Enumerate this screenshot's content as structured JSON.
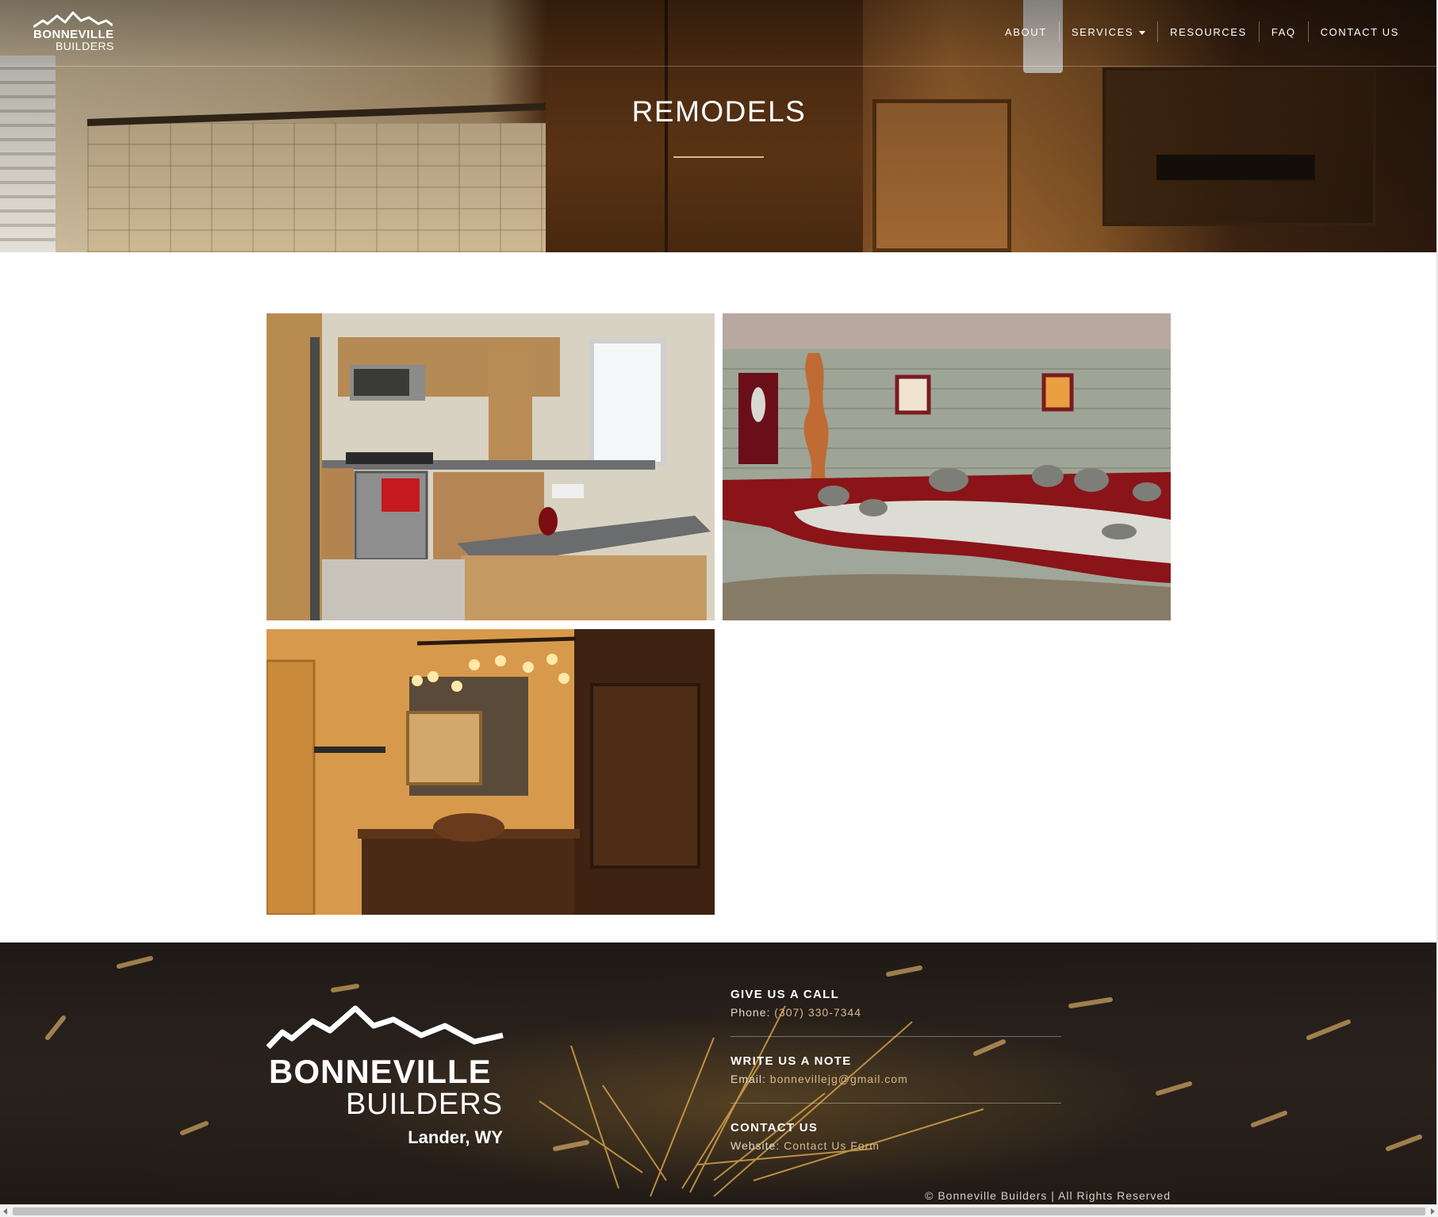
{
  "brand": {
    "name_line1": "BONNEVILLE",
    "name_line2": "BUILDERS",
    "location": "Lander, WY"
  },
  "nav": {
    "items": [
      {
        "label": "ABOUT"
      },
      {
        "label": "SERVICES",
        "has_dropdown": true
      },
      {
        "label": "RESOURCES"
      },
      {
        "label": "FAQ"
      },
      {
        "label": "CONTACT US"
      }
    ]
  },
  "hero": {
    "title": "REMODELS"
  },
  "gallery": {
    "images": [
      {
        "subject": "remodeled kitchen with oak cabinets and stainless appliances"
      },
      {
        "subject": "exterior courtyard with red stamped concrete and rock garden"
      },
      {
        "subject": "rustic bathroom vanity with Edison bulb light fixture"
      }
    ]
  },
  "footer": {
    "call": {
      "heading": "GIVE US A CALL",
      "prefix": "Phone:",
      "value": "(307) 330-7344"
    },
    "note": {
      "heading": "WRITE US A NOTE",
      "prefix": "Email:",
      "value": "bonnevillejg@gmail.com"
    },
    "contact": {
      "heading": "CONTACT US",
      "prefix": "Website:",
      "value": "Contact Us Form"
    },
    "copyright": "© Bonneville Builders | All Rights Reserved"
  },
  "colors": {
    "accent": "#d8b98a",
    "footer_bg": "#221c18",
    "text_light": "#ffffff"
  }
}
